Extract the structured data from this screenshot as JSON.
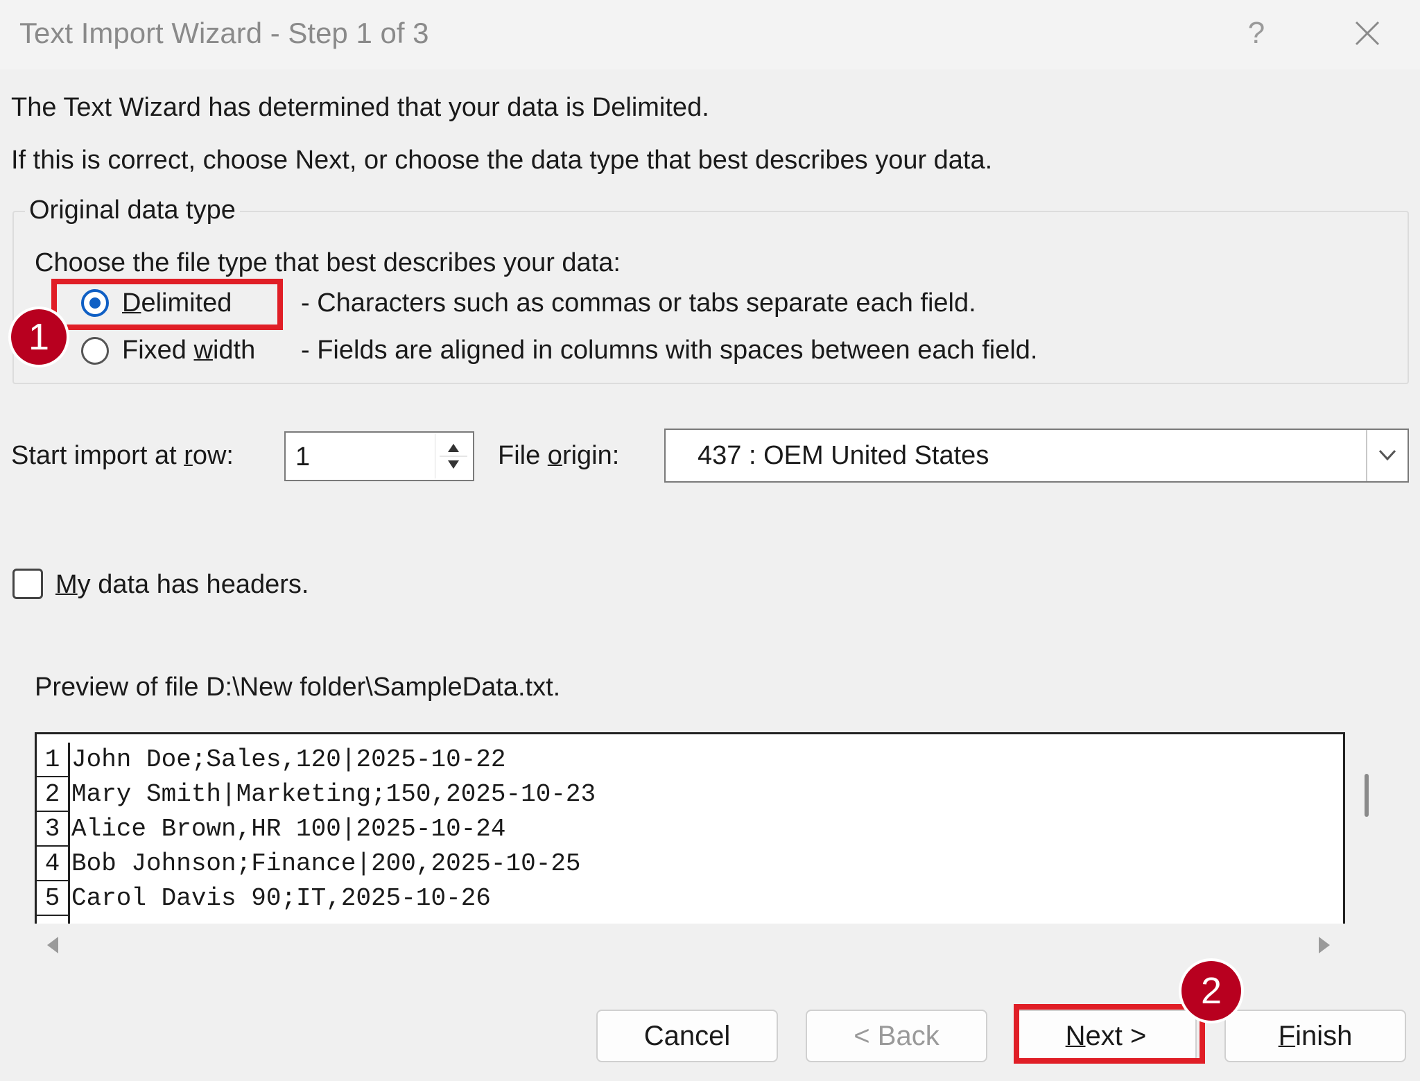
{
  "window": {
    "title": "Text Import Wizard - Step 1 of 3",
    "help_label": "?"
  },
  "intro": {
    "line1": "The Text Wizard has determined that your data is Delimited.",
    "line2": "If this is correct, choose Next, or choose the data type that best describes your data."
  },
  "data_type": {
    "group_label": "Original data type",
    "prompt": "Choose the file type that best describes your data:",
    "options": [
      {
        "label": "Delimited",
        "mnemonic": "D",
        "rest": "elimited",
        "description": "- Characters such as commas or tabs separate each field.",
        "selected": true
      },
      {
        "label": "Fixed width",
        "pre": "Fixed ",
        "mnemonic": "w",
        "rest": "idth",
        "description": "- Fields are aligned in columns with spaces between each field.",
        "selected": false
      }
    ]
  },
  "start_row": {
    "label_pre": "Start import at ",
    "mnemonic": "r",
    "label_post": "ow:",
    "value": "1"
  },
  "file_origin": {
    "label_pre": "File ",
    "mnemonic": "o",
    "label_post": "rigin:",
    "value": "437 : OEM United States"
  },
  "headers_checkbox": {
    "mnemonic": "M",
    "rest": "y data has headers.",
    "checked": false
  },
  "preview": {
    "label": "Preview of file D:\\New folder\\SampleData.txt.",
    "rows": [
      {
        "num": "1",
        "text": "John Doe;Sales,120|2025-10-22"
      },
      {
        "num": "2",
        "text": "Mary Smith|Marketing;150,2025-10-23"
      },
      {
        "num": "3",
        "text": "Alice Brown,HR 100|2025-10-24"
      },
      {
        "num": "4",
        "text": "Bob Johnson;Finance|200,2025-10-25"
      },
      {
        "num": "5",
        "text": "Carol Davis 90;IT,2025-10-26"
      }
    ]
  },
  "buttons": {
    "cancel": "Cancel",
    "back": "< Back",
    "next_mnemonic": "N",
    "next_rest": "ext >",
    "finish_mnemonic": "F",
    "finish_rest": "inish"
  },
  "annotations": {
    "badge1": "1",
    "badge2": "2",
    "highlight_color": "#e01e26",
    "badge_color": "#b8001f"
  },
  "colors": {
    "radio_selected": "#0f5fc4"
  }
}
